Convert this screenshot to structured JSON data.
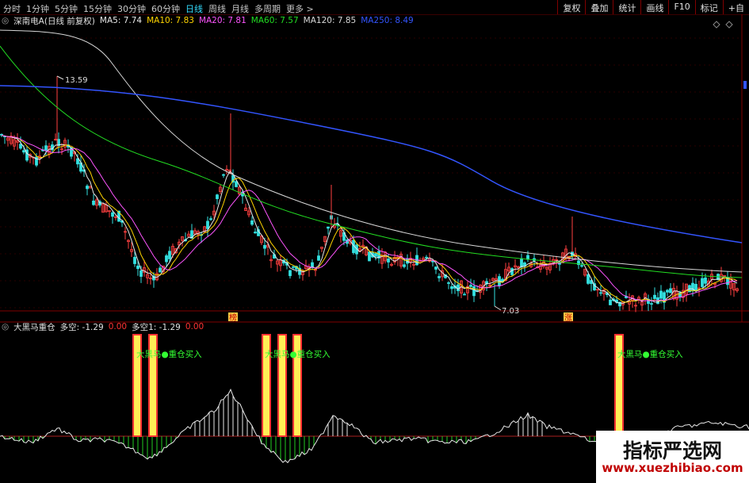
{
  "toolbar": {
    "periods": [
      {
        "label": "分时",
        "active": false
      },
      {
        "label": "1分钟",
        "active": false
      },
      {
        "label": "5分钟",
        "active": false
      },
      {
        "label": "15分钟",
        "active": false
      },
      {
        "label": "30分钟",
        "active": false
      },
      {
        "label": "60分钟",
        "active": false
      },
      {
        "label": "日线",
        "active": true
      },
      {
        "label": "周线",
        "active": false
      },
      {
        "label": "月线",
        "active": false
      },
      {
        "label": "多周期",
        "active": false
      },
      {
        "label": "更多 >",
        "active": false
      }
    ],
    "tools": [
      "复权",
      "叠加",
      "统计",
      "画线",
      "F10",
      "标记",
      "+自"
    ]
  },
  "main_chart": {
    "title": "深南电A(日线 前复权)",
    "ma": [
      {
        "label": "MA5: 7.74",
        "color": "#e8e8e8"
      },
      {
        "label": "MA10: 7.83",
        "color": "#ffd400"
      },
      {
        "label": "MA20: 7.81",
        "color": "#ff55ff"
      },
      {
        "label": "MA60: 7.57",
        "color": "#22dd22"
      },
      {
        "label": "MA120: 7.85",
        "color": "#d8d8d8"
      },
      {
        "label": "MA250: 8.49",
        "color": "#3355ff"
      }
    ],
    "high_label": "13.59",
    "low_label": "7.03",
    "markers": [
      "榜",
      "涨"
    ]
  },
  "sub_chart": {
    "title": "大黑马重仓",
    "values": [
      {
        "label": "多空: -1.29",
        "color": "#e0e0e0"
      },
      {
        "label": "0.00",
        "color": "#ff3333"
      },
      {
        "label": "多空1: -1.29",
        "color": "#e0e0e0"
      },
      {
        "label": "0.00",
        "color": "#ff3333"
      }
    ],
    "signal_text": "大黑马●重仓买入",
    "signal_color": "#33ff33"
  },
  "watermark": {
    "title": "指标严选网",
    "url": "www.xuezhibiao.com"
  },
  "colors": {
    "up": "#ff4040",
    "down": "#33e0e0",
    "grid": "#800000",
    "signal_bar": "#ffee55",
    "signal_edge": "#ff3333"
  }
}
